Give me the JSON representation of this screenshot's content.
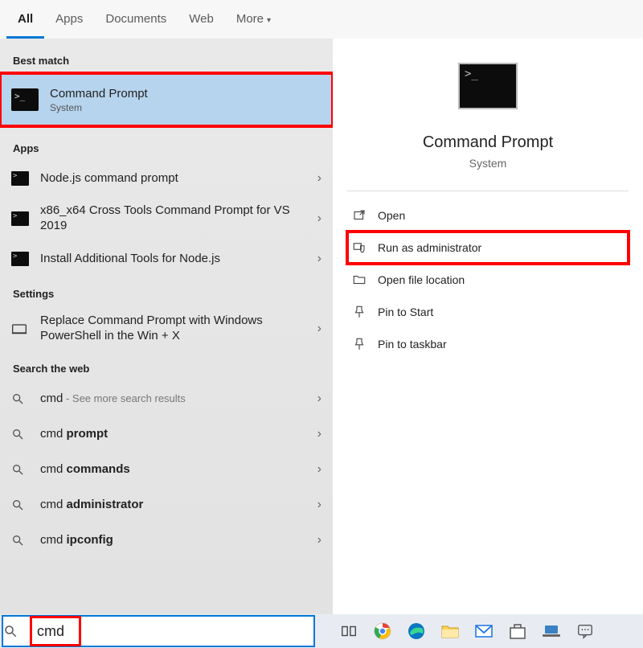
{
  "tabs": {
    "all": "All",
    "apps": "Apps",
    "documents": "Documents",
    "web": "Web",
    "more": "More"
  },
  "sections": {
    "best_match": "Best match",
    "apps": "Apps",
    "settings": "Settings",
    "web": "Search the web"
  },
  "best_match": {
    "title": "Command Prompt",
    "subtitle": "System"
  },
  "apps_list": [
    {
      "label": "Node.js command prompt"
    },
    {
      "label": "x86_x64 Cross Tools Command Prompt for VS 2019"
    },
    {
      "label": "Install Additional Tools for Node.js"
    }
  ],
  "settings_list": [
    {
      "label": "Replace Command Prompt with Windows PowerShell in the Win + X"
    }
  ],
  "web_list": [
    {
      "prefix": "cmd",
      "bold": "",
      "suffix": " - See more search results"
    },
    {
      "prefix": "cmd ",
      "bold": "prompt",
      "suffix": ""
    },
    {
      "prefix": "cmd ",
      "bold": "commands",
      "suffix": ""
    },
    {
      "prefix": "cmd ",
      "bold": "administrator",
      "suffix": ""
    },
    {
      "prefix": "cmd ",
      "bold": "ipconfig",
      "suffix": ""
    }
  ],
  "preview": {
    "title": "Command Prompt",
    "subtitle": "System",
    "actions": {
      "open": "Open",
      "run_admin": "Run as administrator",
      "open_loc": "Open file location",
      "pin_start": "Pin to Start",
      "pin_taskbar": "Pin to taskbar"
    }
  },
  "search": {
    "value": "cmd"
  }
}
